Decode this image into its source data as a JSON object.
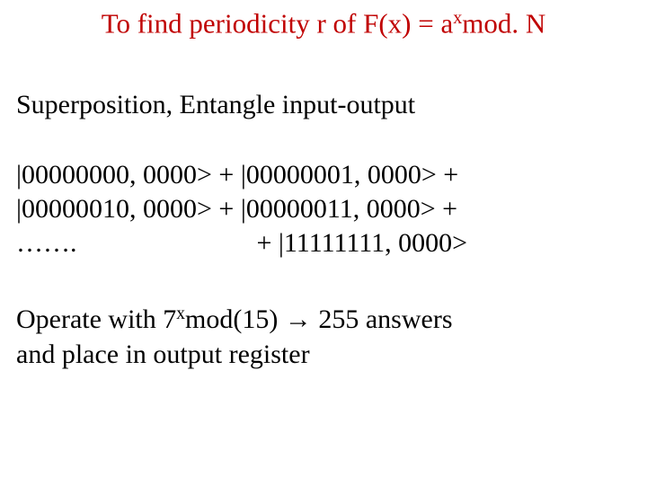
{
  "title_pre": "To find periodicity r of F(x) = a",
  "title_exp": "x",
  "title_post": "mod. N",
  "subtitle": "Superposition, Entangle input-output",
  "kets": {
    "l1": "|00000000, 0000> + |00000001, 0000> +",
    "l2": "|00000010, 0000> + |00000011, 0000> +",
    "l3a": "…….",
    "l3b": "+ |11111111, 0000>"
  },
  "op": {
    "a": "Operate with 7",
    "exp": "x",
    "b": "mod(15) ",
    "arrow": "→",
    "c": " 255 answers",
    "d": "and place in output register"
  }
}
